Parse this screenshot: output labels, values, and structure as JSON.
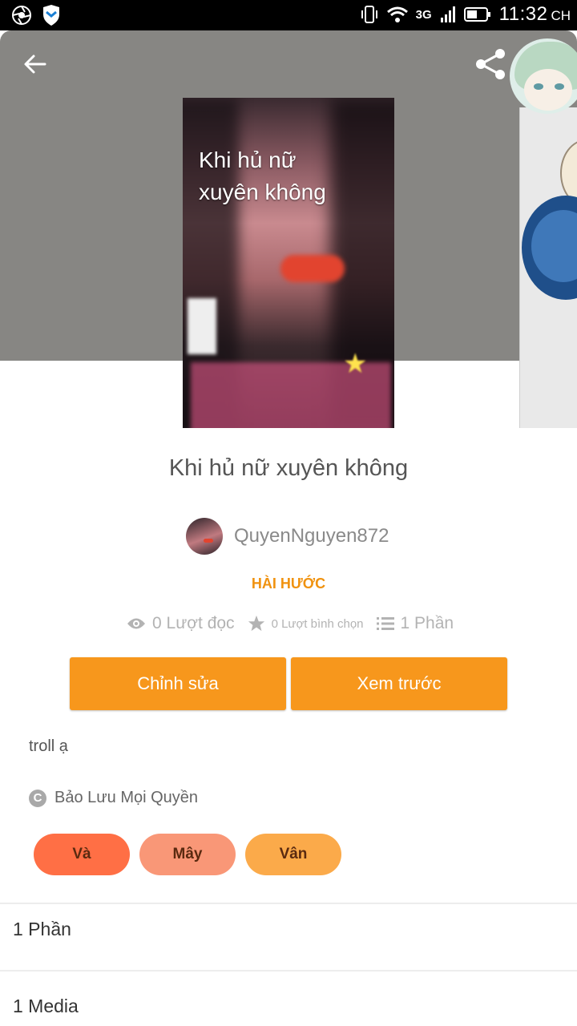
{
  "status_bar": {
    "time": "11:32",
    "time_suffix": "CH",
    "network": "3G"
  },
  "story": {
    "cover_text": "Khi hủ nữ xuyên không",
    "title": "Khi hủ nữ xuyên không",
    "author": "QuyenNguyen872",
    "genre": "HÀI HƯỚC",
    "stats": {
      "reads": "0 Lượt đọc",
      "votes": "0 Lượt bình chọn",
      "parts": "1 Phần"
    },
    "description": "troll ạ",
    "rights": "Bảo Lưu Mọi Quyền"
  },
  "actions": {
    "edit_label": "Chỉnh sửa",
    "preview_label": "Xem trước"
  },
  "tags": [
    "Và",
    "Mây",
    "Vân"
  ],
  "sections": {
    "parts": "1 Phần",
    "media": "1 Media"
  },
  "colors": {
    "accent": "#f7971c",
    "header_bg": "#878683",
    "tag1": "#ff6f45",
    "tag2": "#f99777",
    "tag3": "#fbaa4a"
  },
  "icons": [
    "back-arrow-icon",
    "share-icon",
    "eye-icon",
    "star-icon",
    "list-icon",
    "copyright-icon"
  ]
}
